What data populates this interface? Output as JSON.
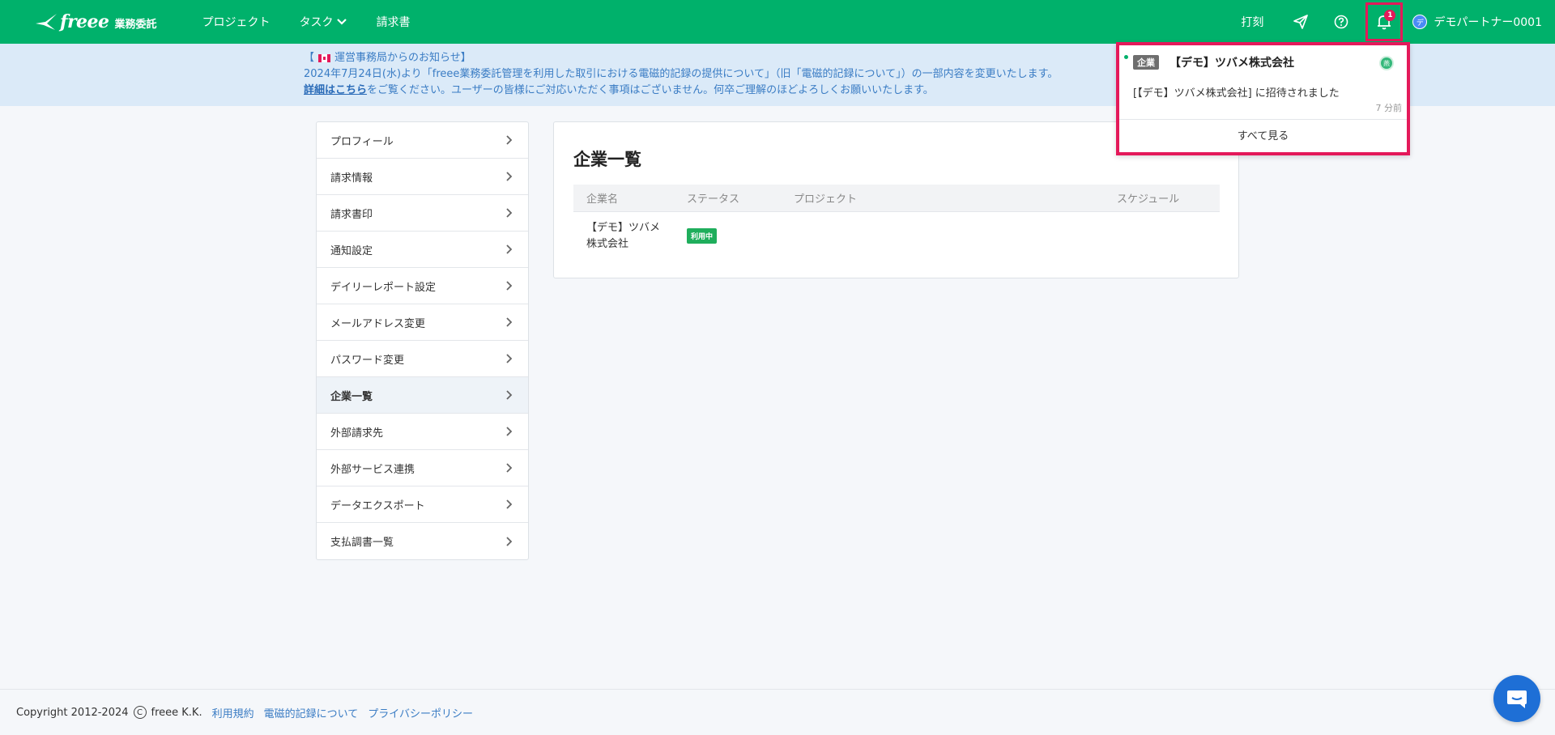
{
  "header": {
    "logo_text": "freee",
    "logo_sub": "業務委託",
    "nav": [
      {
        "label": "プロジェクト"
      },
      {
        "label": "タスク"
      },
      {
        "label": "請求書"
      }
    ],
    "clock_label": "打刻",
    "notification_count": "1",
    "user_initial": "デ",
    "user_name": "デモパートナー0001"
  },
  "announcement": {
    "title_prefix": "【",
    "title_text": "運営事務局からのお知らせ",
    "title_suffix": "】",
    "line1": "2024年7月24日(水)より「freee業務委託管理を利用した取引における電磁的記録の提供について」（旧「電磁的記録について」）の一部内容を変更いたします。",
    "link_text": "詳細はこちら",
    "line2_rest": "をご覧ください。ユーザーの皆様にご対応いただく事項はございません。何卒ご理解のほどよろしくお願いいたします。"
  },
  "sidebar": {
    "items": [
      {
        "label": "プロフィール"
      },
      {
        "label": "請求情報"
      },
      {
        "label": "請求書印"
      },
      {
        "label": "通知設定"
      },
      {
        "label": "デイリーレポート設定"
      },
      {
        "label": "メールアドレス変更"
      },
      {
        "label": "パスワード変更"
      },
      {
        "label": "企業一覧"
      },
      {
        "label": "外部請求先"
      },
      {
        "label": "外部サービス連携"
      },
      {
        "label": "データエクスポート"
      },
      {
        "label": "支払調書一覧"
      }
    ],
    "active_index": 7
  },
  "main": {
    "title": "企業一覧",
    "columns": [
      "企業名",
      "ステータス",
      "プロジェクト",
      "スケジュール"
    ],
    "rows": [
      {
        "company": "【デモ】ツバメ株式会社",
        "status": "利用中",
        "project": "",
        "schedule": ""
      }
    ]
  },
  "notification": {
    "tag": "企業",
    "company": "【デモ】ツバメ株式会社",
    "avatar": "燕",
    "message": "[【デモ】ツバメ株式会社] に招待されました",
    "time": "7 分前",
    "view_all": "すべて見る"
  },
  "footer": {
    "copyright_prefix": "Copyright 2012-2024",
    "copyright_symbol": "C",
    "company": "freee K.K.",
    "links": [
      {
        "label": "利用規約"
      },
      {
        "label": "電磁的記録について"
      },
      {
        "label": "プライバシーポリシー"
      }
    ]
  },
  "colors": {
    "brand_green": "#00b16b",
    "highlight_pink": "#e4195a",
    "status_green": "#1fae5c",
    "link_blue": "#3a7cc4"
  }
}
